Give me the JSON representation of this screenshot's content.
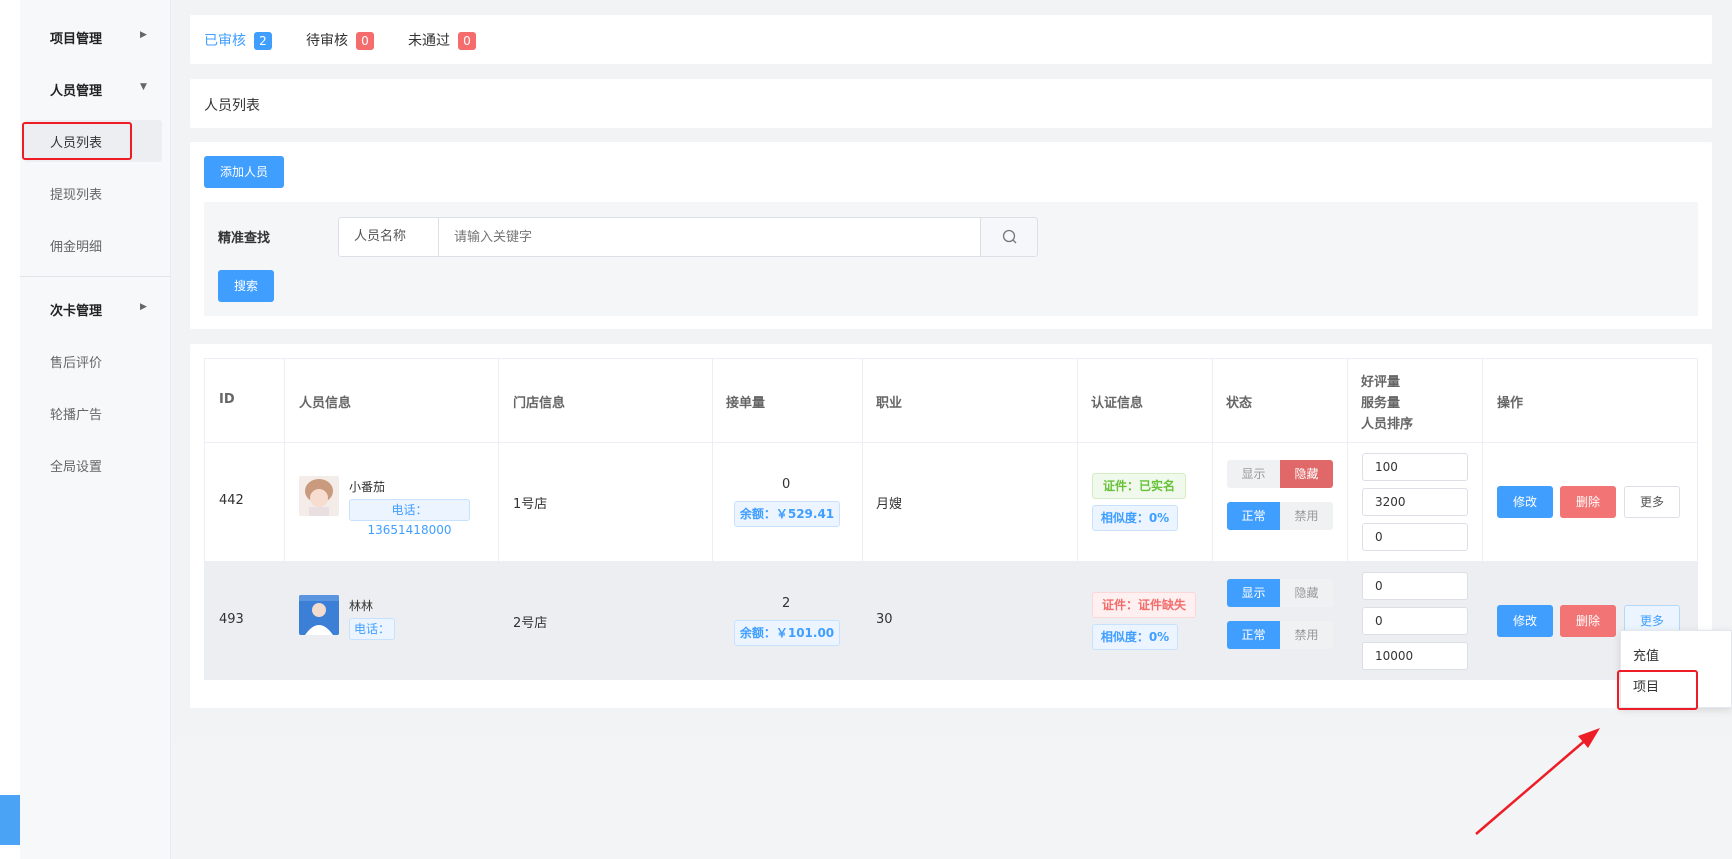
{
  "sidebar": {
    "groups": [
      {
        "label": "项目管理"
      },
      {
        "label": "人员管理"
      },
      {
        "label": "次卡管理"
      }
    ],
    "items": [
      {
        "label": "人员列表"
      },
      {
        "label": "提现列表"
      },
      {
        "label": "佣金明细"
      },
      {
        "label": "售后评价"
      },
      {
        "label": "轮播广告"
      },
      {
        "label": "全局设置"
      }
    ]
  },
  "tabs": [
    {
      "label": "已审核",
      "count": "2"
    },
    {
      "label": "待审核",
      "count": "0"
    },
    {
      "label": "未通过",
      "count": "0"
    }
  ],
  "breadcrumb": "人员列表",
  "toolbar": {
    "add_label": "添加人员"
  },
  "search": {
    "label": "精准查找",
    "field_label": "人员名称",
    "placeholder": "请输入关键字",
    "button": "搜索"
  },
  "table": {
    "headers": {
      "id": "ID",
      "person": "人员信息",
      "store": "门店信息",
      "orders": "接单量",
      "job": "职业",
      "cert": "认证信息",
      "status": "状态",
      "metrics": [
        "好评量",
        "服务量",
        "人员排序"
      ],
      "ops": "操作"
    },
    "rows": [
      {
        "id": "442",
        "name": "小番茄",
        "phone": "电话：13651418000",
        "store": "1号店",
        "orders": "0",
        "balance": "余额：￥529.41",
        "job": "月嫂",
        "cert": "证件：已实名",
        "similarity": "相似度：0%",
        "show": "显示",
        "hide": "隐藏",
        "normal": "正常",
        "disable": "禁用",
        "good_reviews": "100",
        "service_count": "3200",
        "sort": "0",
        "edit": "修改",
        "delete": "删除",
        "more": "更多"
      },
      {
        "id": "493",
        "name": "林林",
        "phone": "电话：",
        "store": "2号店",
        "orders": "2",
        "balance": "余额：￥101.00",
        "job": "30",
        "cert": "证件：证件缺失",
        "similarity": "相似度：0%",
        "show": "显示",
        "hide": "隐藏",
        "normal": "正常",
        "disable": "禁用",
        "good_reviews": "0",
        "service_count": "0",
        "sort": "10000",
        "edit": "修改",
        "delete": "删除",
        "more": "更多"
      }
    ]
  },
  "dropdown": {
    "items": [
      "充值",
      "项目"
    ]
  },
  "colors": {
    "primary": "#409eff",
    "danger": "#f56c6c",
    "annotation": "#ee1c25"
  }
}
